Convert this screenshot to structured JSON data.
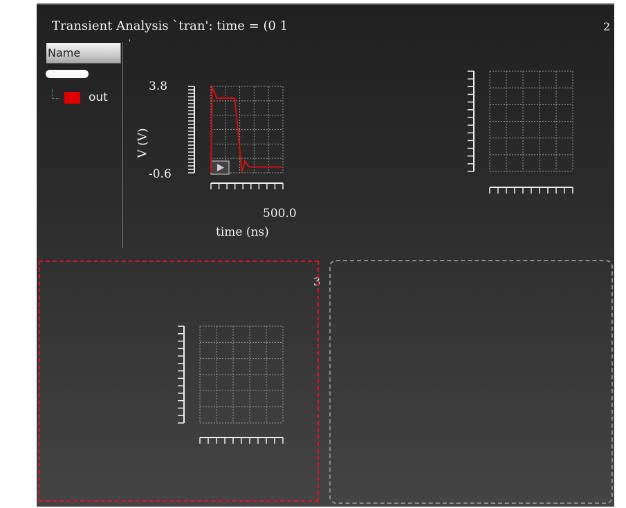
{
  "window": {
    "title": "Transient Analysis `tran': time = (0    1",
    "subplot_numbers": [
      "2",
      "3"
    ]
  },
  "legend": {
    "header": "Name",
    "traces": [
      {
        "label": "out",
        "color": "#e00000"
      }
    ]
  },
  "plot1": {
    "y_top_label": "3.8",
    "y_bottom_label": "-0.6",
    "ylabel": "V (V)",
    "x_end_label": "500.0",
    "xlabel": "time (ns)"
  },
  "colors": {
    "trace": "#d01010",
    "selection_border": "#e0102a",
    "empty_border": "#8c8c8c",
    "grid": "#9a9a9a",
    "ticks": "#f0f0f0"
  },
  "chart_data": {
    "type": "line",
    "series": [
      {
        "name": "out",
        "x": [
          0,
          8,
          40,
          80,
          120,
          165,
          215,
          235,
          265,
          300,
          500
        ],
        "y": [
          -0.6,
          3.8,
          3.2,
          3.2,
          3.2,
          3.2,
          -0.55,
          0.0,
          -0.3,
          -0.3,
          -0.3
        ]
      }
    ],
    "xlabel": "time (ns)",
    "ylabel": "V (V)",
    "xlim": [
      0,
      500
    ],
    "ylim": [
      -0.6,
      3.8
    ],
    "grid": true
  }
}
